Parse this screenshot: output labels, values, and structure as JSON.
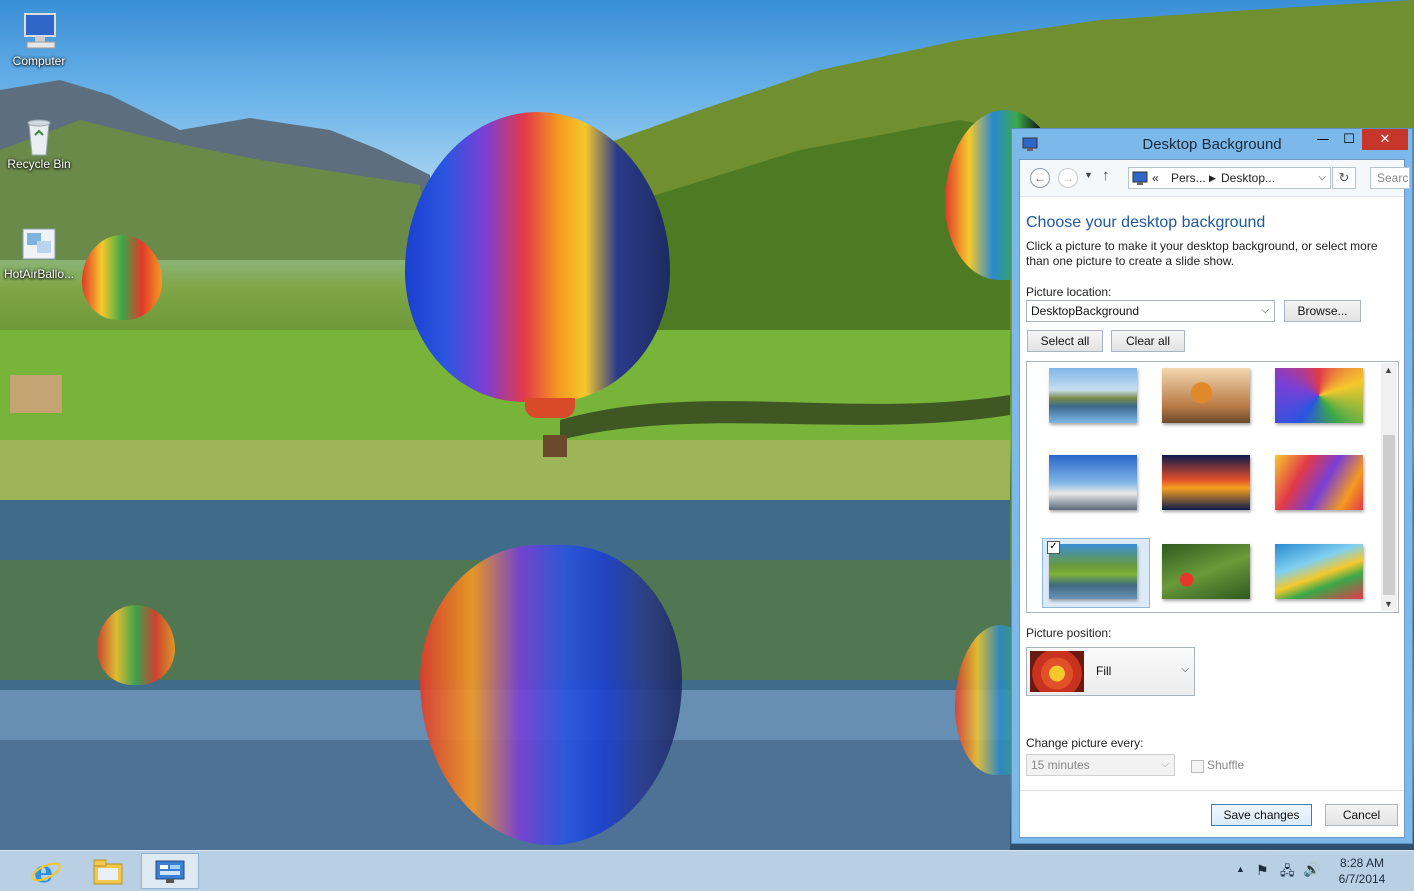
{
  "desktop": {
    "icons": [
      {
        "label": "Computer",
        "icon": "computer-icon"
      },
      {
        "label": "Recycle Bin",
        "icon": "recycle-bin-icon"
      },
      {
        "label": "HotAirBallo...",
        "icon": "theme-file-icon"
      }
    ]
  },
  "taskbar": {
    "apps": [
      {
        "name": "Internet Explorer",
        "icon": "internet-explorer-icon"
      },
      {
        "name": "File Explorer",
        "icon": "file-explorer-icon"
      },
      {
        "name": "Control Panel",
        "icon": "control-panel-icon"
      }
    ],
    "time": "8:28 AM",
    "date": "6/7/2014"
  },
  "window": {
    "title": "Desktop Background",
    "breadcrumb": {
      "sep": "«",
      "item1": "Pers...",
      "item2": "Desktop..."
    },
    "search_placeholder": "Search",
    "heading": "Choose your desktop background",
    "description": "Click a picture to make it your desktop background, or select more than one picture to create a slide show.",
    "picture_location_label": "Picture location:",
    "picture_location_value": "DesktopBackground",
    "browse_label": "Browse...",
    "select_all_label": "Select all",
    "clear_all_label": "Clear all",
    "thumbnails": [
      {
        "checked": false
      },
      {
        "checked": false
      },
      {
        "checked": false
      },
      {
        "checked": false
      },
      {
        "checked": false
      },
      {
        "checked": false
      },
      {
        "checked": true
      },
      {
        "checked": false
      },
      {
        "checked": false
      }
    ],
    "picture_position_label": "Picture position:",
    "picture_position_value": "Fill",
    "change_every_label": "Change picture every:",
    "change_every_value": "15 minutes",
    "shuffle_label": "Shuffle",
    "save_label": "Save changes",
    "cancel_label": "Cancel"
  },
  "colors": {
    "accent": "#1e5aa0",
    "close": "#c7362b",
    "titlebar": "#7db8ea"
  }
}
